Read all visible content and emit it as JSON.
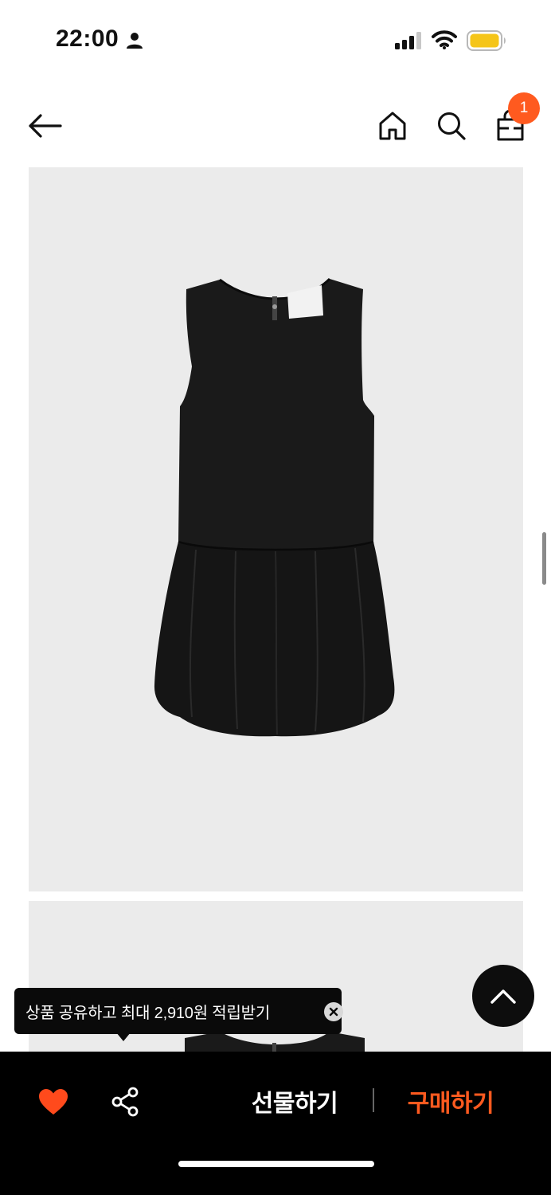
{
  "status_bar": {
    "time": "22:00",
    "icons": [
      "person-icon",
      "signal-icon",
      "wifi-icon",
      "battery-icon"
    ]
  },
  "header": {
    "icons": [
      "back-arrow-icon",
      "home-icon",
      "search-icon",
      "shopping-bag-icon"
    ],
    "cart_count": "1"
  },
  "product": {
    "images": [
      "dress-front-image",
      "dress-partial-image"
    ]
  },
  "share_tooltip": {
    "text": "상품 공유하고 최대 2,910원 적립받기"
  },
  "bottom_bar": {
    "gift_label": "선물하기",
    "buy_label": "구매하기",
    "icons": [
      "heart-icon",
      "share-icon"
    ]
  },
  "colors": {
    "accent": "#ff5a1f",
    "heart": "#ff4a1c",
    "battery": "#f5c518",
    "image_bg": "#ebebeb",
    "bar_bg": "#000000"
  }
}
